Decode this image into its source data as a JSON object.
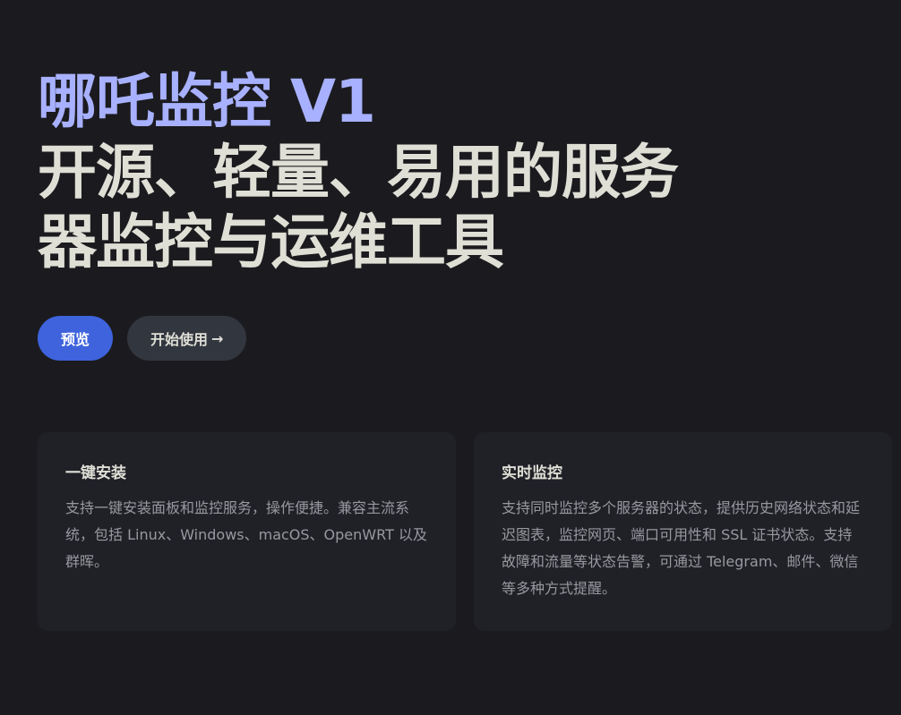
{
  "hero": {
    "name": "哪吒监控 V1",
    "text": "开源、轻量、易用的服务器监控与运维工具"
  },
  "actions": {
    "preview_label": "预览",
    "get_started_label": "开始使用",
    "get_started_arrow": "→"
  },
  "features": [
    {
      "title": "一键安装",
      "details": "支持一键安装面板和监控服务，操作便捷。兼容主流系统，包括 Linux、Windows、macOS、OpenWRT 以及群晖。"
    },
    {
      "title": "实时监控",
      "details": "支持同时监控多个服务器的状态，提供历史网络状态和延迟图表，监控网页、端口可用性和 SSL 证书状态。支持故障和流量等状态告警，可通过 Telegram、邮件、微信等多种方式提醒。"
    }
  ],
  "colors": {
    "background": "#1b1b1f",
    "brand_name": "#a8b1ff",
    "brand_button": "#3e63dd",
    "alt_button": "#32363f",
    "card_background": "#202127"
  }
}
